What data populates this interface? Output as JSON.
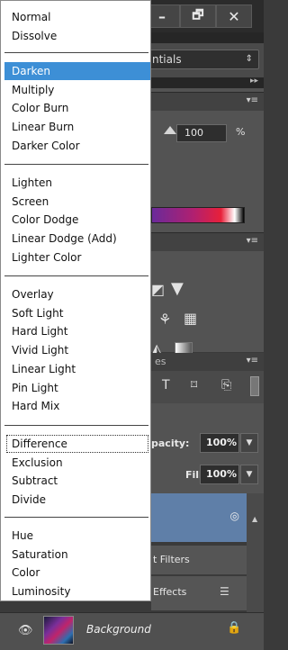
{
  "window": {
    "minimize": "–",
    "restore": "🗗",
    "close": "✕"
  },
  "workspace": {
    "value": "ntials"
  },
  "adjust": {
    "value": "100",
    "unit": "%"
  },
  "layers": {
    "tab_fragment": "es",
    "opacity_label": "pacity:",
    "opacity_value": "100%",
    "fill_label": "Fill:",
    "fill_value": "100%",
    "filters_label": "t Filters",
    "effects_label": "Effects",
    "background_layer": "Background"
  },
  "blend_modes": {
    "groups": [
      [
        "Normal",
        "Dissolve"
      ],
      [
        "Darken",
        "Multiply",
        "Color Burn",
        "Linear Burn",
        "Darker Color"
      ],
      [
        "Lighten",
        "Screen",
        "Color Dodge",
        "Linear Dodge (Add)",
        "Lighter Color"
      ],
      [
        "Overlay",
        "Soft Light",
        "Hard Light",
        "Vivid Light",
        "Linear Light",
        "Pin Light",
        "Hard Mix"
      ],
      [
        "Difference",
        "Exclusion",
        "Subtract",
        "Divide"
      ],
      [
        "Hue",
        "Saturation",
        "Color",
        "Luminosity"
      ]
    ],
    "selected": "Darken",
    "focused": "Difference"
  },
  "colors": {
    "selection": "#3d8fd6",
    "panel": "#535353",
    "dark": "#2b2b2b"
  }
}
